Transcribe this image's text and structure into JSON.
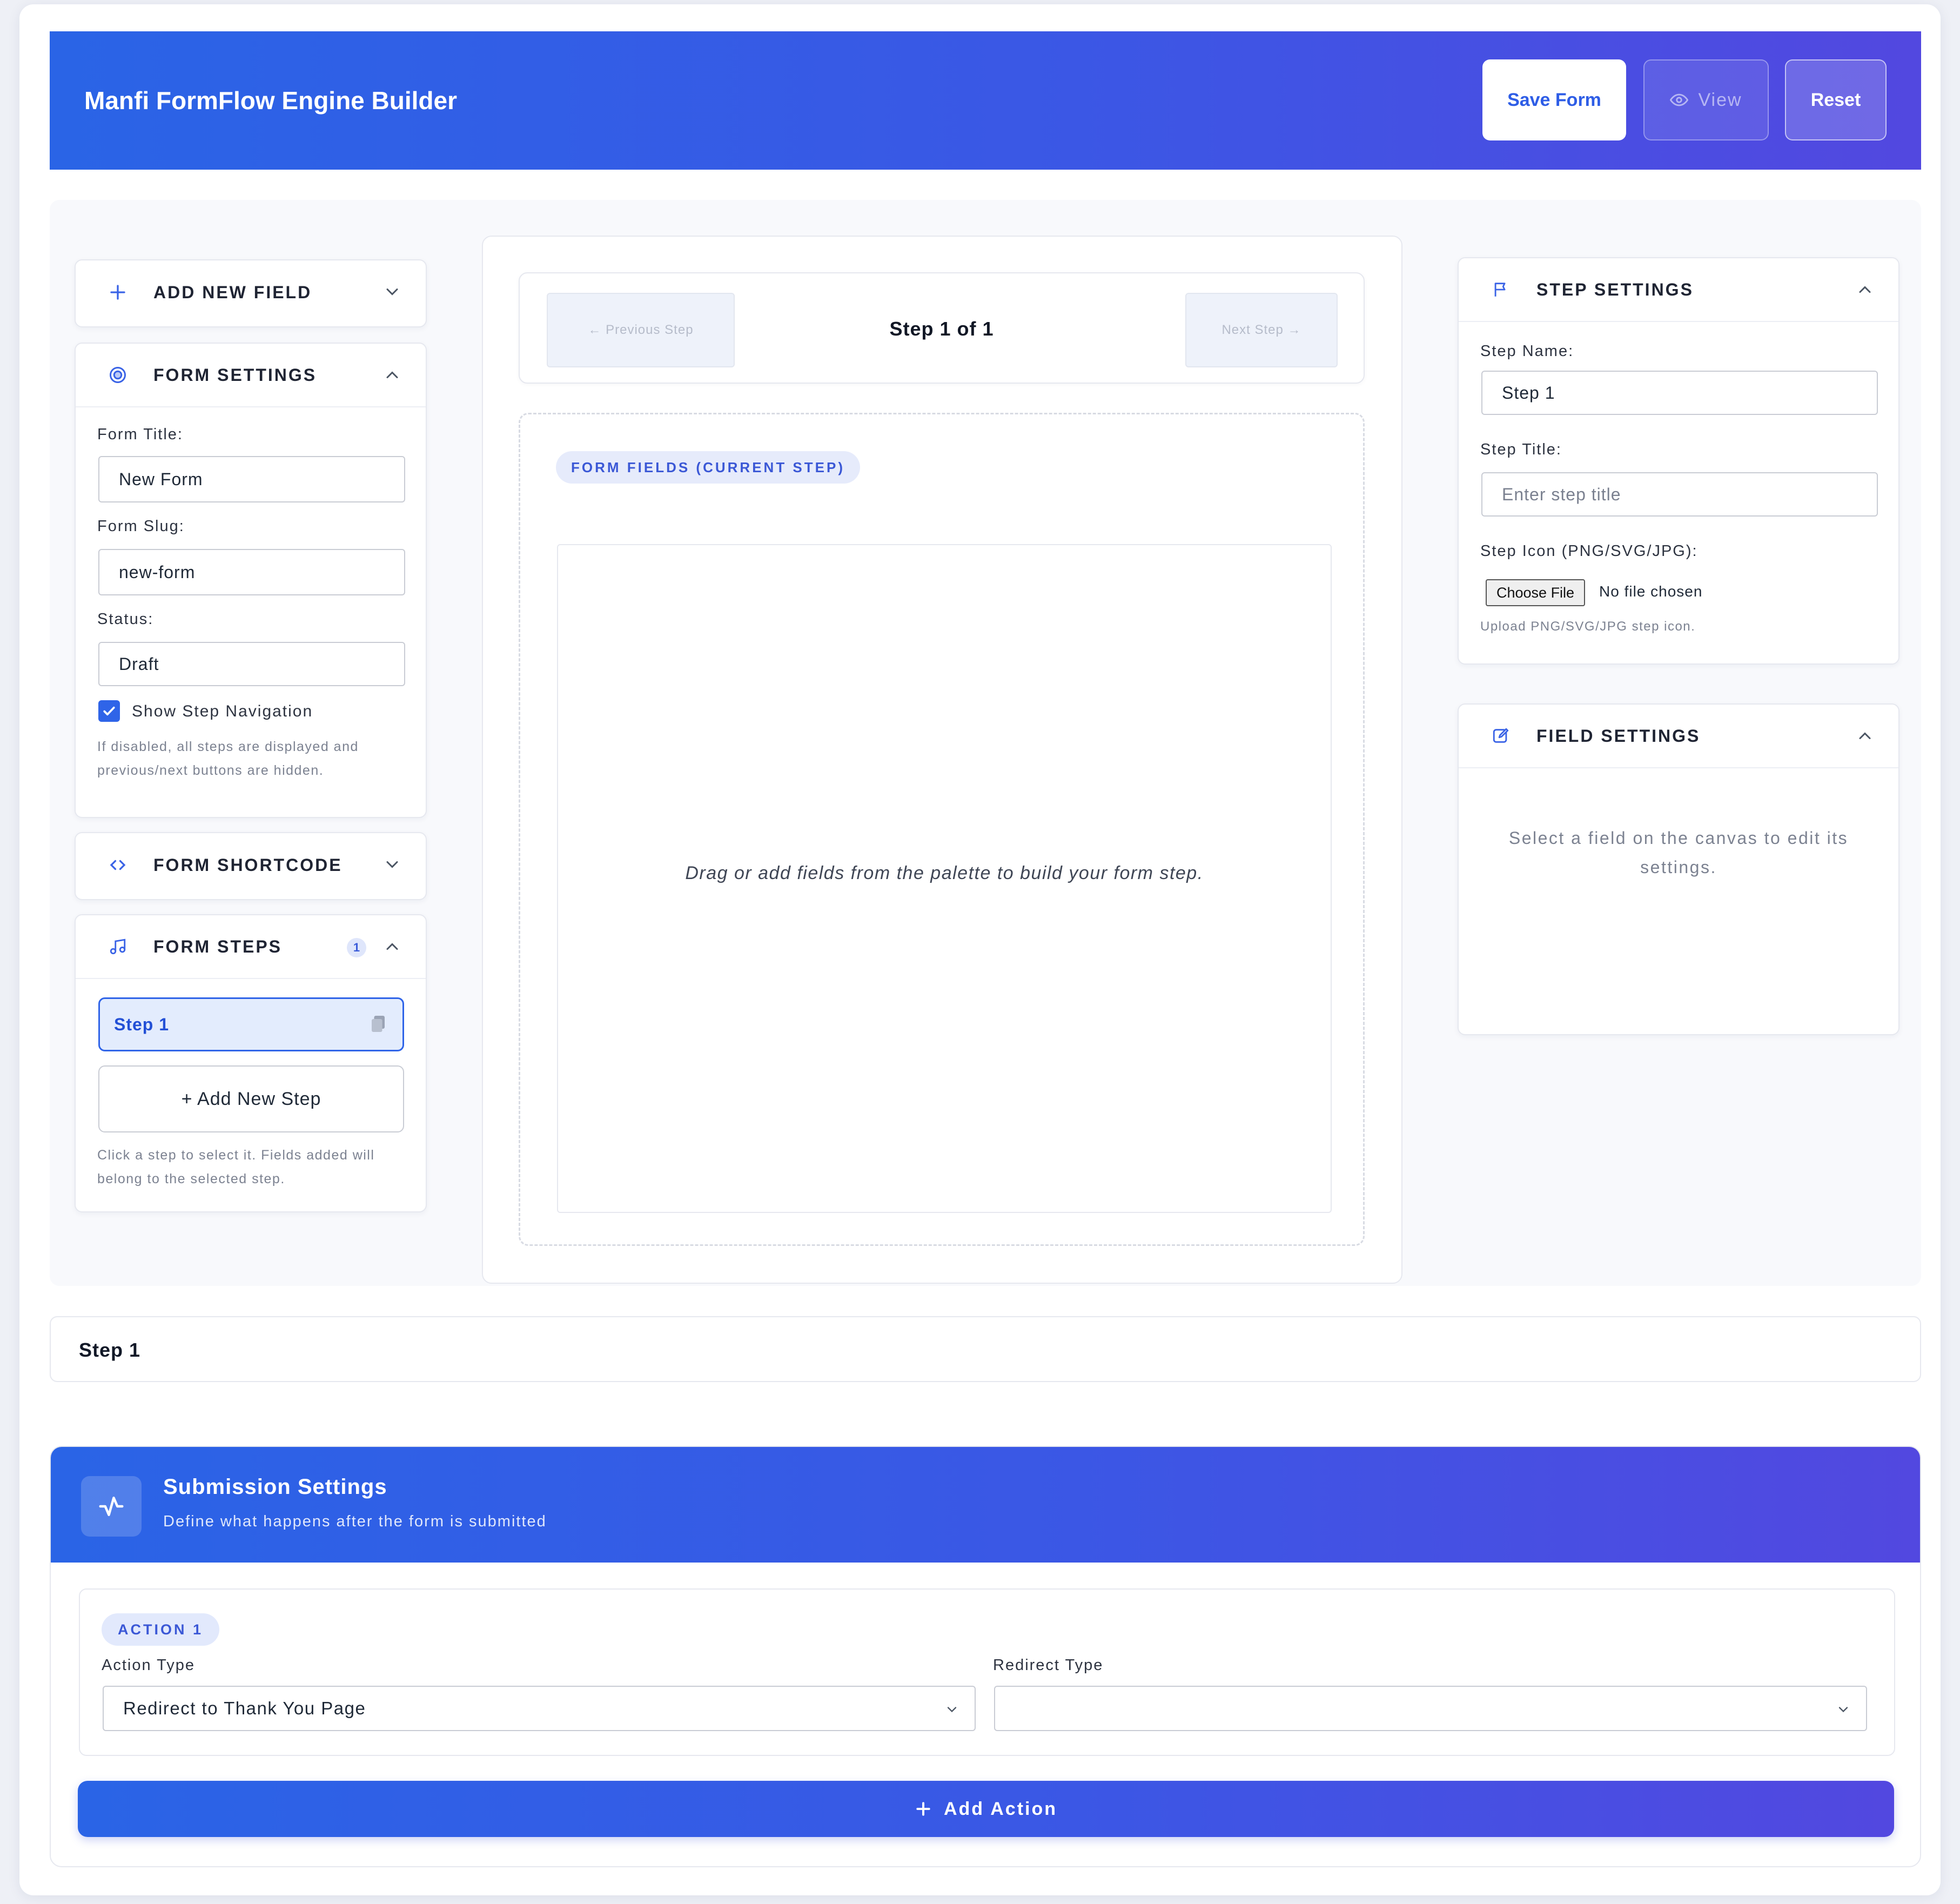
{
  "app": {
    "title": "Manfi FormFlow Engine Builder",
    "save_label": "Save Form",
    "view_label": "View",
    "reset_label": "Reset",
    "accent": "#2f64e8",
    "gradient_start": "#2a64e6",
    "gradient_end": "#5248e0"
  },
  "left": {
    "add_field": {
      "label": "ADD NEW FIELD",
      "icon": "plus-icon"
    },
    "form_settings": {
      "label": "FORM SETTINGS",
      "icon": "target-icon",
      "title_label": "Form Title:",
      "title_value": "New Form",
      "slug_label": "Form Slug:",
      "slug_value": "new-form",
      "status_label": "Status:",
      "status_value": "Draft",
      "nav_label": "Show Step Navigation",
      "nav_checked": true,
      "help_line1": "If disabled, all steps are displayed and",
      "help_line2": "previous/next buttons are hidden."
    },
    "shortcode": {
      "label": "FORM SHORTCODE",
      "icon": "code-icon"
    },
    "steps": {
      "label": "FORM STEPS",
      "icon": "music-note-icon",
      "count": "1",
      "items": [
        {
          "label": "Step 1"
        }
      ],
      "add_label": "+ Add New Step",
      "help_line1": "Click a step to select it. Fields added will",
      "help_line2": "belong to the selected step."
    }
  },
  "canvas": {
    "prev_label": "← Previous Step",
    "next_label": "Next Step →",
    "step_indicator": "Step 1 of 1",
    "pill": "FORM FIELDS (CURRENT STEP)",
    "empty_message": "Drag or add fields from the palette to build your form step."
  },
  "right": {
    "step_settings": {
      "label": "STEP SETTINGS",
      "icon": "flag-icon",
      "name_label": "Step Name:",
      "name_value": "Step 1",
      "title_label": "Step Title:",
      "title_placeholder": "Enter step title",
      "icon_label": "Step Icon (PNG/SVG/JPG):",
      "choose_label": "Choose File",
      "no_file": "No file chosen",
      "help": "Upload PNG/SVG/JPG step icon."
    },
    "field_settings": {
      "label": "FIELD SETTINGS",
      "icon": "edit-icon",
      "message_line1": "Select a field on the canvas to edit its",
      "message_line2": "settings."
    }
  },
  "breadcrumb": {
    "label": "Step 1"
  },
  "submission": {
    "title": "Submission Settings",
    "subtitle": "Define what happens after the form is submitted",
    "icon": "activity-icon",
    "actions": [
      {
        "badge": "ACTION 1",
        "action_type_label": "Action Type",
        "action_type_value": "Redirect to Thank You Page",
        "redirect_type_label": "Redirect Type",
        "redirect_type_value": ""
      }
    ],
    "add_action_label": "Add Action"
  }
}
